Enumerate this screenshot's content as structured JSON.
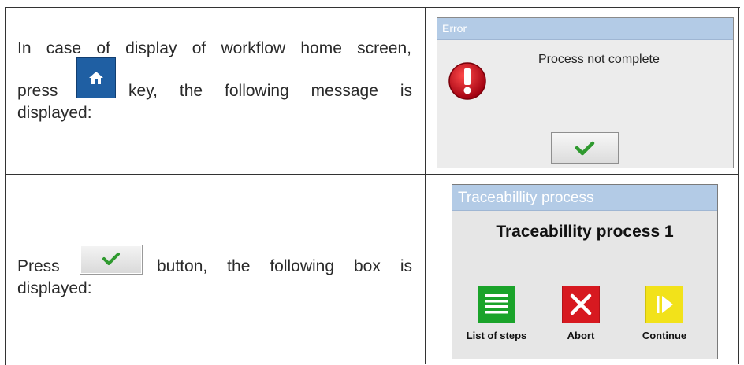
{
  "rows": [
    {
      "text_before_key": "In case of display of workflow home screen,",
      "text_press": "press",
      "text_after_key": "key, the following message is",
      "text_end": "displayed:",
      "key_icon": "home-icon"
    },
    {
      "text_press": "Press",
      "text_after_key": "button, the following box is",
      "text_end": "displayed:",
      "key_icon": "checkmark-icon"
    }
  ],
  "error_dialog": {
    "title": "Error",
    "message": "Process not complete",
    "icon": "exclamation-icon",
    "ok_icon": "checkmark-icon"
  },
  "traceability_dialog": {
    "title": "Traceabillity process",
    "heading": "Traceabillity process 1",
    "buttons": [
      {
        "label": "List of steps",
        "icon": "list-icon",
        "color": "#1aa32a"
      },
      {
        "label": "Abort",
        "icon": "close-icon",
        "color": "#d71920"
      },
      {
        "label": "Continue",
        "icon": "play-icon",
        "color": "#f2e21a"
      }
    ]
  },
  "colors": {
    "titlebar": "#b3cbe6",
    "home_key": "#1f5fa3",
    "check_green": "#2f9a2f",
    "error_red": "#c8101a"
  }
}
